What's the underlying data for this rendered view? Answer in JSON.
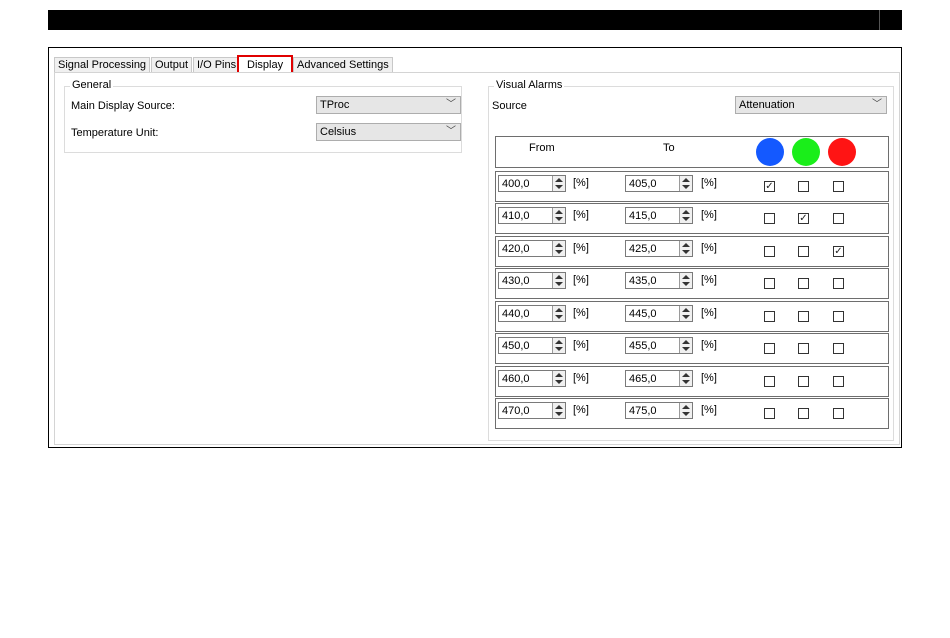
{
  "tabs": [
    {
      "label": "Signal Processing",
      "active": false
    },
    {
      "label": "Output",
      "active": false
    },
    {
      "label": "I/O Pins",
      "active": false
    },
    {
      "label": "Display",
      "active": true
    },
    {
      "label": "Advanced Settings",
      "active": false
    }
  ],
  "general": {
    "title": "General",
    "main_display_source_label": "Main Display Source:",
    "main_display_source_value": "TProc",
    "temperature_unit_label": "Temperature Unit:",
    "temperature_unit_value": "Celsius"
  },
  "visual_alarms": {
    "title": "Visual Alarms",
    "source_label": "Source",
    "source_value": "Attenuation",
    "header_from": "From",
    "header_to": "To",
    "indicator_colors": [
      "#1459ff",
      "#1aee1a",
      "#ff1414"
    ],
    "unit": "[%]",
    "check_mark": "✓",
    "rows": [
      {
        "from": "400,0",
        "to": "405,0",
        "checks": [
          true,
          false,
          false
        ]
      },
      {
        "from": "410,0",
        "to": "415,0",
        "checks": [
          false,
          true,
          false
        ]
      },
      {
        "from": "420,0",
        "to": "425,0",
        "checks": [
          false,
          false,
          true
        ]
      },
      {
        "from": "430,0",
        "to": "435,0",
        "checks": [
          false,
          false,
          false
        ]
      },
      {
        "from": "440,0",
        "to": "445,0",
        "checks": [
          false,
          false,
          false
        ]
      },
      {
        "from": "450,0",
        "to": "455,0",
        "checks": [
          false,
          false,
          false
        ]
      },
      {
        "from": "460,0",
        "to": "465,0",
        "checks": [
          false,
          false,
          false
        ]
      },
      {
        "from": "470,0",
        "to": "475,0",
        "checks": [
          false,
          false,
          false
        ]
      }
    ]
  }
}
